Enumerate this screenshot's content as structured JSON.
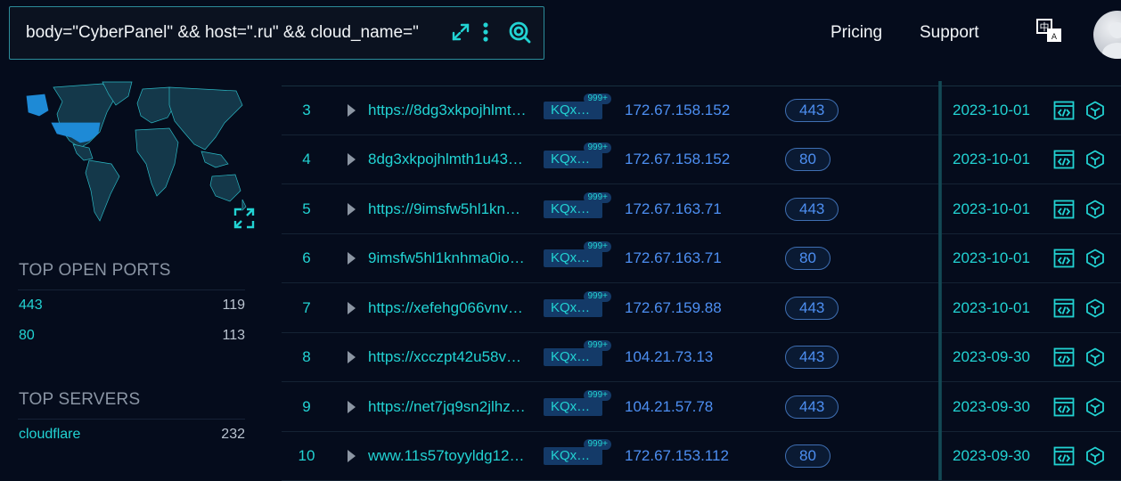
{
  "header": {
    "search_query": "body=\"CyberPanel\" && host=\".ru\" && cloud_name=\"",
    "nav": [
      {
        "label": "Pricing"
      },
      {
        "label": "Support"
      }
    ],
    "lang_icon": "translate-icon",
    "avatar_icon": "user-avatar"
  },
  "sidebar": {
    "map": {
      "highlighted_country": "United States",
      "highlight_color": "#1e8ad6"
    },
    "top_open_ports": {
      "title": "TOP OPEN PORTS",
      "items": [
        {
          "key": "443",
          "count": "119"
        },
        {
          "key": "80",
          "count": "113"
        }
      ]
    },
    "top_servers": {
      "title": "TOP SERVERS",
      "items": [
        {
          "key": "cloudflare",
          "count": "232"
        }
      ]
    }
  },
  "table": {
    "rows": [
      {
        "index": "3",
        "url": "https://8dg3xkpojhlmt…",
        "tag": "KQx…",
        "tag_badge": "999+",
        "ip": "172.67.158.152",
        "port": "443",
        "date": "2023-10-01"
      },
      {
        "index": "4",
        "url": "8dg3xkpojhlmth1u43…",
        "tag": "KQx…",
        "tag_badge": "999+",
        "ip": "172.67.158.152",
        "port": "80",
        "date": "2023-10-01"
      },
      {
        "index": "5",
        "url": "https://9imsfw5hl1kn…",
        "tag": "KQx…",
        "tag_badge": "999+",
        "ip": "172.67.163.71",
        "port": "443",
        "date": "2023-10-01"
      },
      {
        "index": "6",
        "url": "9imsfw5hl1knhma0io…",
        "tag": "KQx…",
        "tag_badge": "999+",
        "ip": "172.67.163.71",
        "port": "80",
        "date": "2023-10-01"
      },
      {
        "index": "7",
        "url": "https://xefehg066vnv…",
        "tag": "KQx…",
        "tag_badge": "999+",
        "ip": "172.67.159.88",
        "port": "443",
        "date": "2023-10-01"
      },
      {
        "index": "8",
        "url": "https://xcczpt42u58v…",
        "tag": "KQx…",
        "tag_badge": "999+",
        "ip": "104.21.73.13",
        "port": "443",
        "date": "2023-09-30"
      },
      {
        "index": "9",
        "url": "https://net7jq9sn2jlhz…",
        "tag": "KQx…",
        "tag_badge": "999+",
        "ip": "104.21.57.78",
        "port": "443",
        "date": "2023-09-30"
      },
      {
        "index": "10",
        "url": "www.11s57toyyldg12…",
        "tag": "KQx…",
        "tag_badge": "999+",
        "ip": "172.67.153.112",
        "port": "80",
        "date": "2023-09-30"
      }
    ]
  },
  "colors": {
    "accent_cyan": "#22d3d3",
    "ip_blue": "#4d8ff2",
    "background": "#050c1c"
  }
}
